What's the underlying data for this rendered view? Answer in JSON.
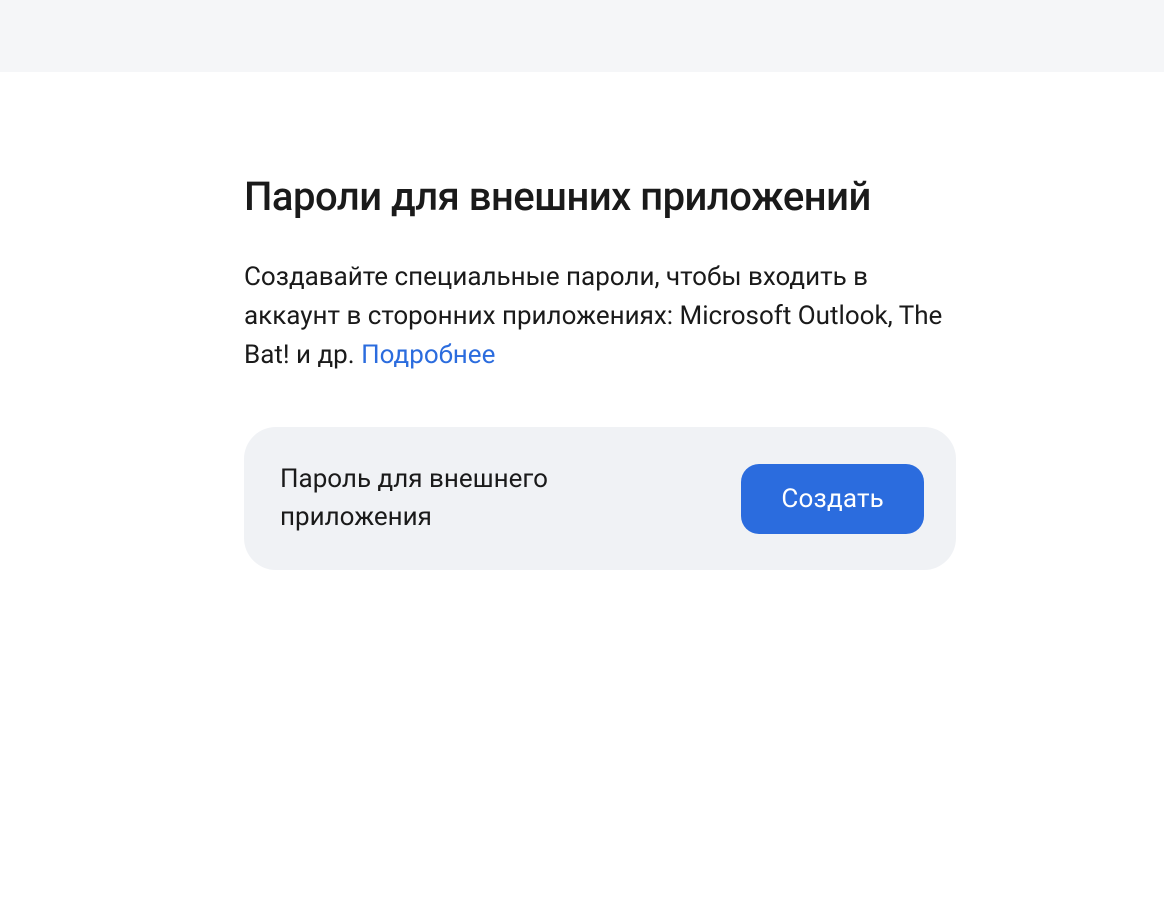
{
  "page": {
    "title": "Пароли для внешних приложений",
    "description_text": "Создавайте специальные пароли, чтобы входить в аккаунт в сторонних приложениях: Microsoft Outlook, The Bat! и др. ",
    "more_link_label": "Подробнее"
  },
  "card": {
    "label": "Пароль для внешнего приложения",
    "create_button_label": "Создать"
  }
}
